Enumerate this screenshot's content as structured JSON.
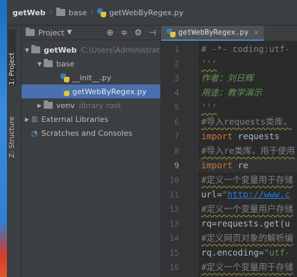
{
  "navbar": {
    "breadcrumbs": [
      "getWeb",
      "base",
      "getWebByRegex.py"
    ]
  },
  "sidetabs": {
    "project": "1: Project",
    "structure": "Z: Structure"
  },
  "project_panel": {
    "title": "Project",
    "tree": [
      {
        "label": "getWeb",
        "extra": "C:\\Users\\Administrat",
        "indent": 0,
        "expanded": true,
        "type": "folder"
      },
      {
        "label": "base",
        "extra": "",
        "indent": 1,
        "expanded": true,
        "type": "folder"
      },
      {
        "label": "__init__.py",
        "extra": "",
        "indent": 2,
        "type": "python"
      },
      {
        "label": "getWebByRegex.py",
        "extra": "",
        "indent": 2,
        "type": "python",
        "selected": true
      },
      {
        "label": "venv",
        "extra": "library root",
        "indent": 1,
        "expanded": false,
        "type": "folder"
      },
      {
        "label": "External Libraries",
        "extra": "",
        "indent": 0,
        "expanded": false,
        "type": "library"
      },
      {
        "label": "Scratches and Consoles",
        "extra": "",
        "indent": 0,
        "type": "scratch"
      }
    ]
  },
  "editor": {
    "tab_label": "getWebByRegex.py",
    "current_line": 9,
    "lines": [
      {
        "n": "1",
        "text": "# -*- coding:utf-",
        "cls": "c-com"
      },
      {
        "n": "2",
        "text": "'''",
        "cls": "c-doc"
      },
      {
        "n": "3",
        "text": "作者：刘日辉",
        "cls": "c-doc"
      },
      {
        "n": "4",
        "text": "用途：教学演示",
        "cls": "c-doc"
      },
      {
        "n": "5",
        "text": "'''",
        "cls": "c-doc"
      },
      {
        "n": "6",
        "text": "#导入requests类库，",
        "cls": "c-com"
      },
      {
        "n": "7",
        "text": "import requests",
        "cls": "import"
      },
      {
        "n": "8",
        "text": "#导入re类库，用于使用",
        "cls": "c-com"
      },
      {
        "n": "9",
        "text": "import re",
        "cls": "import"
      },
      {
        "n": "10",
        "text": "#定义一个变量用于存储",
        "cls": "c-com"
      },
      {
        "n": "11",
        "text": "url=\"http://www.c",
        "cls": "url"
      },
      {
        "n": "12",
        "text": "#定义一个变量用户存储",
        "cls": "c-com"
      },
      {
        "n": "13",
        "text": "rq=requests.get(u",
        "cls": "c-id"
      },
      {
        "n": "14",
        "text": "#定义网页对象的解析编",
        "cls": "c-com"
      },
      {
        "n": "15",
        "text": "rq.encoding=\"utf-",
        "cls": "enc"
      },
      {
        "n": "16",
        "text": "#定义一个变量用于存储",
        "cls": "c-com"
      }
    ]
  }
}
